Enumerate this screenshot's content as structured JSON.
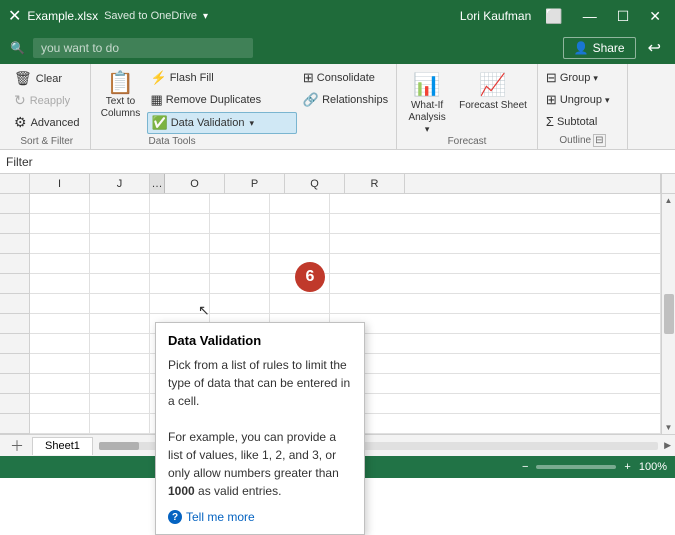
{
  "titlebar": {
    "filename": "Example.xlsx",
    "save_status": "Saved to OneDrive",
    "user": "Lori Kaufman",
    "restore_icon": "⬜",
    "minimize_icon": "—",
    "maximize_icon": "☐",
    "close_icon": "✕"
  },
  "searchbar": {
    "placeholder": "you want to do",
    "share_label": "Share",
    "undo_icon": "↩"
  },
  "ribbon": {
    "sort_filter_group": {
      "label": "Sort & Filter",
      "clear_label": "Clear",
      "reapply_label": "Reapply",
      "advanced_label": "Advanced"
    },
    "data_tools_group": {
      "label": "Data Tools",
      "flash_fill_label": "Flash Fill",
      "remove_duplicates_label": "Remove Duplicates",
      "data_validation_label": "Data Validation",
      "consolidate_label": "Consolidate",
      "relationships_label": "Relationships",
      "text_to_columns_label": "Text to Columns"
    },
    "forecast_group": {
      "label": "Forecast",
      "what_if_label": "What-If\nAnalysis",
      "forecast_sheet_label": "Forecast\nSheet"
    },
    "outline_group": {
      "label": "Outline",
      "group_label": "Group",
      "ungroup_label": "Ungroup",
      "subtotal_label": "Subtotal",
      "collapse_icon": "⊟"
    }
  },
  "filter_bar": {
    "label": "Filter"
  },
  "columns": [
    "I",
    "J",
    "O",
    "P",
    "Q",
    "R"
  ],
  "tooltip": {
    "title": "Data Validation",
    "line1": "Pick from a list of rules to limit the",
    "line2": "type of data that can be entered in a",
    "line3": "cell.",
    "line4": "For example, you can provide a list",
    "line5": "of values, like 1, 2, and 3, or only",
    "line6": "allow numbers greater than",
    "bold_part": "1000",
    "line7": "as valid entries.",
    "tell_me_more": "Tell me more",
    "help_icon": "?"
  },
  "badge": {
    "number": "6"
  },
  "statusbar": {
    "zoom_label": "100%",
    "minus": "−",
    "plus": "+"
  }
}
